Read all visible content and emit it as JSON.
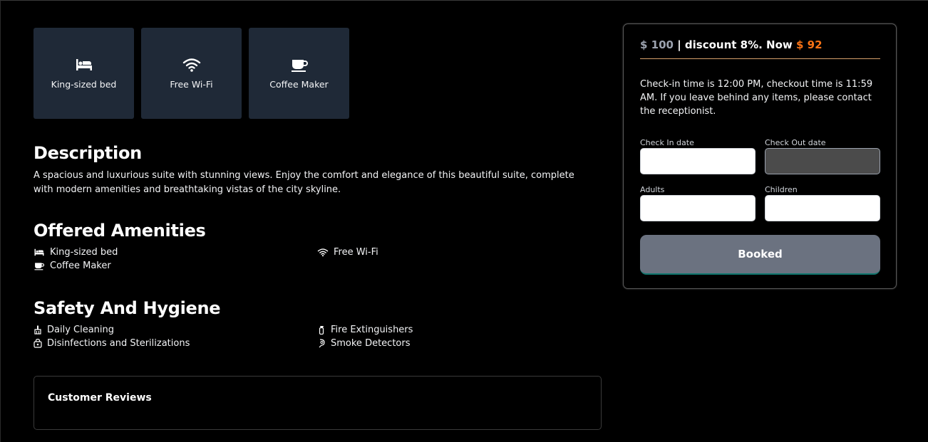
{
  "tiles": [
    {
      "icon": "bed-icon",
      "label": "King-sized bed"
    },
    {
      "icon": "wifi-icon",
      "label": "Free Wi-Fi"
    },
    {
      "icon": "coffee-icon",
      "label": "Coffee Maker"
    }
  ],
  "description": {
    "title": "Description",
    "text": "A spacious and luxurious suite with stunning views. Enjoy the comfort and elegance of this beautiful suite, complete with modern amenities and breathtaking vistas of the city skyline."
  },
  "amenities": {
    "title": "Offered Amenities",
    "items": [
      {
        "icon": "bed-icon",
        "label": "King-sized bed"
      },
      {
        "icon": "wifi-icon",
        "label": "Free Wi-Fi"
      },
      {
        "icon": "coffee-icon",
        "label": "Coffee Maker"
      }
    ]
  },
  "safety": {
    "title": "Safety And Hygiene",
    "items": [
      {
        "icon": "cleaning-icon",
        "label": "Daily Cleaning"
      },
      {
        "icon": "fire-extinguisher-icon",
        "label": "Fire Extinguishers"
      },
      {
        "icon": "sterilization-icon",
        "label": "Disinfections and Sterilizations"
      },
      {
        "icon": "smoke-detector-icon",
        "label": "Smoke Detectors"
      }
    ]
  },
  "reviews": {
    "title": "Customer Reviews"
  },
  "booking": {
    "price_original": "$ 100",
    "price_separator": " | discount 8%. Now ",
    "price_now": "$ 92",
    "policy": "Check-in time is 12:00 PM, checkout time is 11:59 AM. If you leave behind any items, please contact the receptionist.",
    "checkin_label": "Check In date",
    "checkout_label": "Check Out date",
    "adults_label": "Adults",
    "children_label": "Children",
    "checkin_value": "",
    "checkout_value": "",
    "adults_value": "",
    "children_value": "",
    "button_label": "Booked"
  },
  "colors": {
    "tile_bg": "#1f2937",
    "accent_orange": "#f97316",
    "muted_price": "#9ca3af",
    "button_bg": "#6b7280"
  }
}
